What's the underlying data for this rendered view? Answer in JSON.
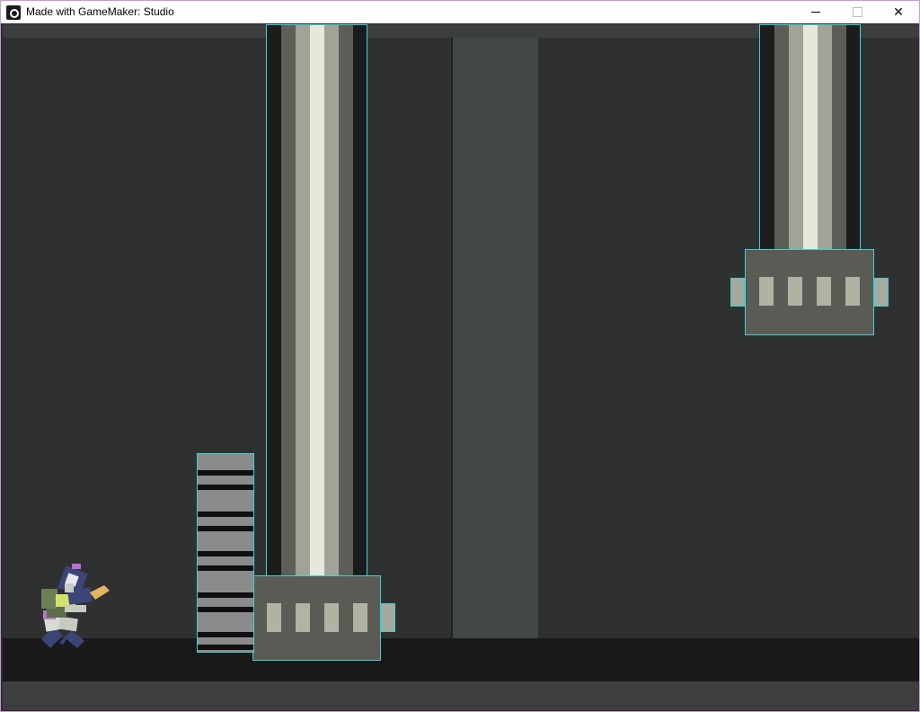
{
  "window": {
    "title": "Made with GameMaker: Studio",
    "controls": {
      "minimize": "",
      "maximize": "",
      "close": "✕"
    }
  },
  "icons": [
    "gamemaker-icon",
    "minimize-icon",
    "maximize-icon",
    "close-icon"
  ],
  "colors": {
    "background": "#2f3130",
    "wall_column": "#424645",
    "floor": "#191919",
    "collision_outline": "#3fd0d4",
    "piston_head": "#5a5b55",
    "player_armor": "#3c4577",
    "player_accent": "#d3e36a"
  }
}
